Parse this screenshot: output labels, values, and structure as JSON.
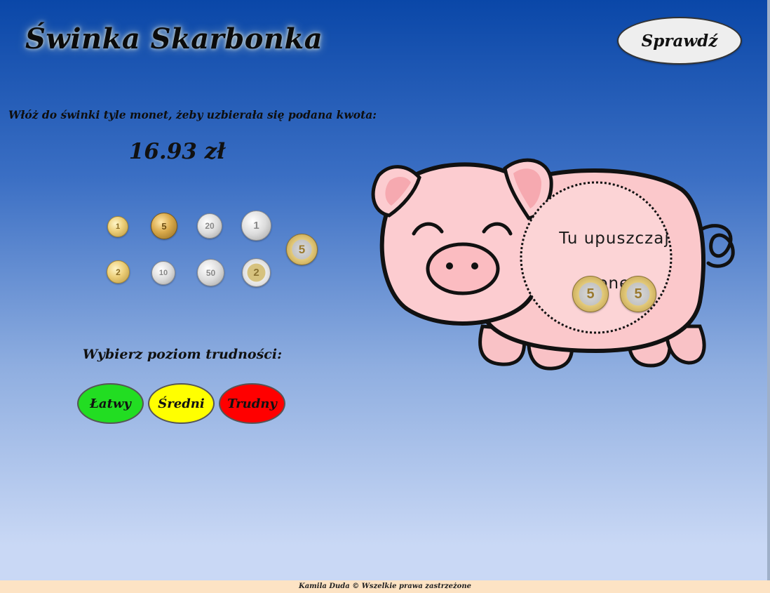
{
  "header": {
    "title": "Świnka Skarbonka",
    "check_button_label": "Sprawdź"
  },
  "task": {
    "instruction": "Włóż do świnki tyle monet, żeby uzbierała się podana kwota:",
    "amount": "16.93 zł"
  },
  "coins": [
    {
      "label": "1",
      "kind": "gold"
    },
    {
      "label": "5",
      "kind": "bronze"
    },
    {
      "label": "20",
      "kind": "silver"
    },
    {
      "label": "1",
      "kind": "silver"
    },
    {
      "label": "5",
      "kind": "bimetal-five"
    },
    {
      "label": "2",
      "kind": "gold"
    },
    {
      "label": "10",
      "kind": "silver"
    },
    {
      "label": "50",
      "kind": "silver"
    },
    {
      "label": "2",
      "kind": "bimetal-sg"
    }
  ],
  "piggy": {
    "dropzone_text": "Tu upuszczaj monety",
    "dropped_coins": [
      "5",
      "5"
    ]
  },
  "difficulty": {
    "label": "Wybierz poziom trudności:",
    "levels": [
      {
        "label": "Łatwy",
        "color": "#22dd22"
      },
      {
        "label": "Średni",
        "color": "#ffff00"
      },
      {
        "label": "Trudny",
        "color": "#ff0000"
      }
    ]
  },
  "footer": {
    "text": "Kamila Duda © Wszelkie prawa zastrzeżone"
  }
}
